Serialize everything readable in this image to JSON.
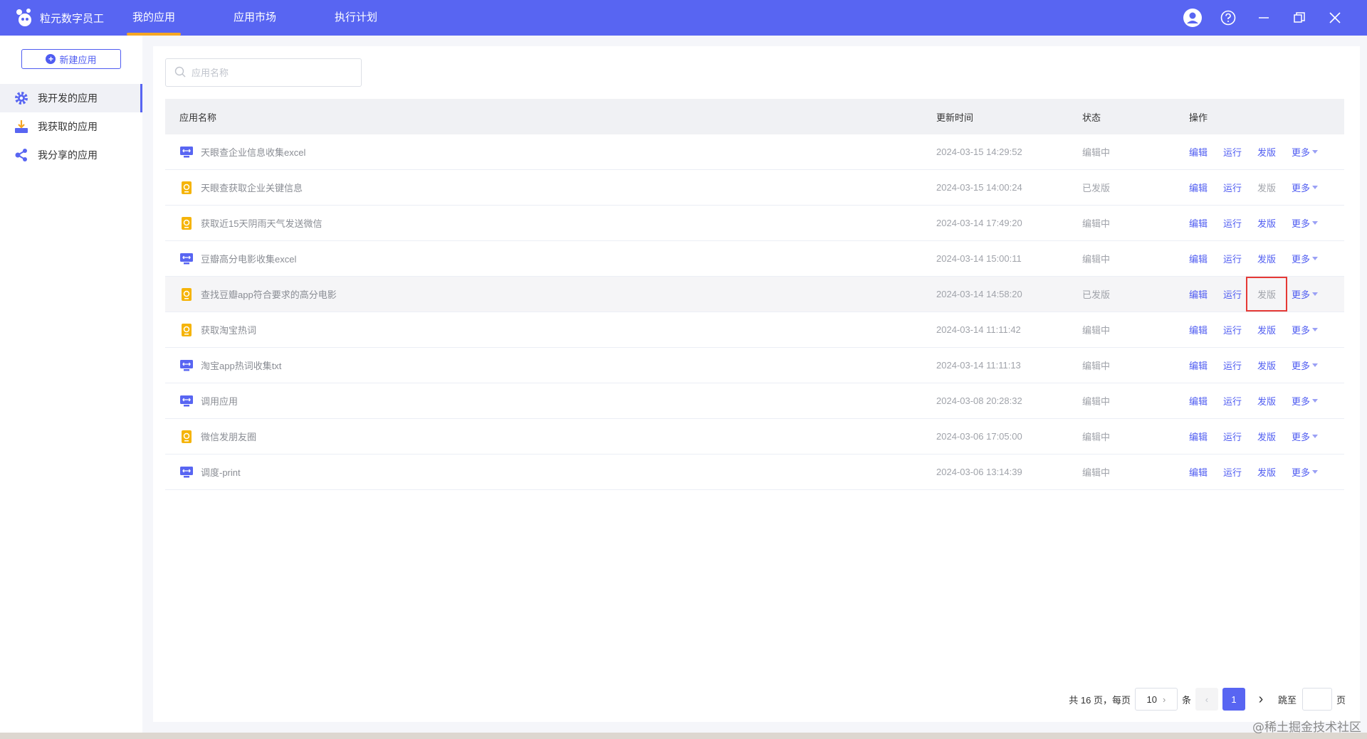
{
  "app": {
    "brand_name": "粒元数字员工",
    "nav": [
      {
        "label": "我的应用",
        "active": true
      },
      {
        "label": "应用市场",
        "active": false
      },
      {
        "label": "执行计划",
        "active": false
      }
    ],
    "top_icons": [
      "user-icon",
      "help-icon",
      "minimize-icon",
      "restore-icon",
      "close-icon"
    ]
  },
  "sidebar": {
    "new_button": "新建应用",
    "items": [
      {
        "label": "我开发的应用",
        "icon": "gear-icon",
        "active": true
      },
      {
        "label": "我获取的应用",
        "icon": "download-icon",
        "active": false
      },
      {
        "label": "我分享的应用",
        "icon": "share-icon",
        "active": false
      }
    ]
  },
  "search": {
    "placeholder": "应用名称",
    "value": ""
  },
  "table": {
    "headers": {
      "name": "应用名称",
      "time": "更新时间",
      "status": "状态",
      "ops": "操作"
    },
    "ops": {
      "edit": "编辑",
      "run": "运行",
      "publish": "发版",
      "more": "更多"
    },
    "rows": [
      {
        "name": "天眼查企业信息收集excel",
        "icon": "desktop-app-icon",
        "time": "2024-03-15 14:29:52",
        "status": "编辑中"
      },
      {
        "name": "天眼查获取企业关键信息",
        "icon": "mobile-app-icon",
        "time": "2024-03-15 14:00:24",
        "status": "已发版"
      },
      {
        "name": "获取近15天阴雨天气发送微信",
        "icon": "mobile-app-icon",
        "time": "2024-03-14 17:49:20",
        "status": "编辑中"
      },
      {
        "name": "豆瓣高分电影收集excel",
        "icon": "desktop-app-icon",
        "time": "2024-03-14 15:00:11",
        "status": "编辑中"
      },
      {
        "name": "查找豆瓣app符合要求的高分电影",
        "icon": "mobile-app-icon",
        "time": "2024-03-14 14:58:20",
        "status": "已发版"
      },
      {
        "name": "获取淘宝热词",
        "icon": "mobile-app-icon",
        "time": "2024-03-14 11:11:42",
        "status": "编辑中"
      },
      {
        "name": "淘宝app热词收集txt",
        "icon": "desktop-app-icon",
        "time": "2024-03-14 11:11:13",
        "status": "编辑中"
      },
      {
        "name": "调用应用",
        "icon": "desktop-app-icon",
        "time": "2024-03-08 20:28:32",
        "status": "编辑中"
      },
      {
        "name": "微信发朋友圈",
        "icon": "mobile-app-icon",
        "time": "2024-03-06 17:05:00",
        "status": "编辑中"
      },
      {
        "name": "调度-print",
        "icon": "desktop-app-icon",
        "time": "2024-03-06 13:14:39",
        "status": "编辑中"
      }
    ]
  },
  "pagination": {
    "total_text": "共 16 页，每页",
    "page_size": "10",
    "unit": "条",
    "current_page": "1",
    "jump_label": "跳至",
    "page_suffix": "页"
  },
  "watermark": "@稀土掘金技术社区",
  "colors": {
    "primary": "#5865f2",
    "accent_underline": "#f5a623",
    "highlight_box": "#e53935",
    "desktop_icon": "#5865f2",
    "mobile_icon": "#f5b40a"
  }
}
